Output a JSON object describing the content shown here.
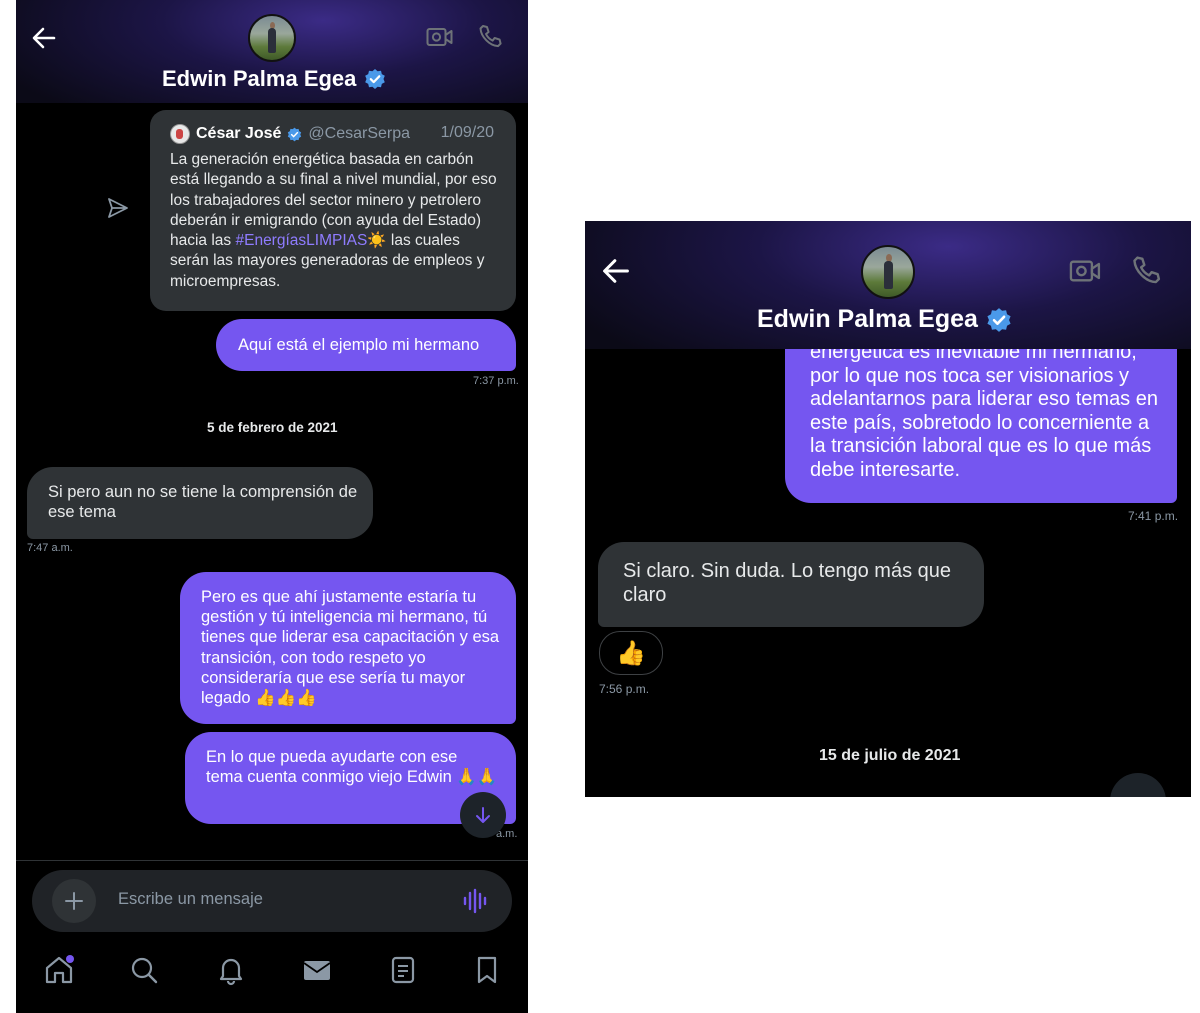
{
  "left": {
    "header": {
      "title": "Edwin Palma Egea",
      "back_icon": "back-arrow-icon",
      "video_icon": "video-camera-icon",
      "phone_icon": "phone-icon"
    },
    "quoted_tweet": {
      "name": "César José",
      "handle": "@CesarSerpa",
      "date": "1/09/20",
      "text_before_hashtag": "La generación energética basada en carbón está llegando a su final a nivel mundial, por eso los trabajadores del sector minero y petrolero deberán ir emigrando (con ayuda del Estado) hacia las ",
      "hashtag": "#EnergíasLIMPIAS",
      "text_after_hashtag": "☀️ las cuales serán las mayores generadoras de empleos y microempresas."
    },
    "messages": [
      {
        "text": "Aquí está el ejemplo mi hermano",
        "time": "7:37 p.m."
      },
      {
        "date_separator": "5 de febrero de 2021"
      },
      {
        "text": "Si pero aun no se tiene la comprensión de ese tema",
        "time": "7:47 a.m."
      },
      {
        "text": "Pero es que ahí justamente estaría tu gestión y tú inteligencia mi hermano, tú tienes que liderar esa capacitación y esa transición, con todo respeto yo consideraría que ese sería tu mayor legado 👍👍👍"
      },
      {
        "text": "En lo que pueda ayudarte con ese tema cuenta conmigo viejo Edwin 🙏🙏",
        "time": "a.m."
      }
    ],
    "composer": {
      "placeholder": "Escribe un mensaje"
    },
    "tabs": [
      "home-icon",
      "search-icon",
      "bell-icon",
      "mail-icon",
      "lists-icon",
      "bookmark-icon"
    ],
    "colors": {
      "accent": "#7556f0",
      "bubble_other": "#2f3336",
      "background": "#000000"
    }
  },
  "right": {
    "header": {
      "title": "Edwin Palma Egea"
    },
    "messages": [
      {
        "text": "energética es inevitable mi hermano, por lo que nos toca ser visionarios y adelantarnos para liderar eso temas en este país, sobretodo lo concerniente a la transición laboral que es lo que más debe interesarte.",
        "time": "7:41 p.m."
      },
      {
        "text": "Si claro. Sin duda. Lo tengo más que claro"
      },
      {
        "emoji": "👍",
        "time": "7:56 p.m."
      },
      {
        "date_separator": "15 de julio de 2021"
      }
    ]
  }
}
